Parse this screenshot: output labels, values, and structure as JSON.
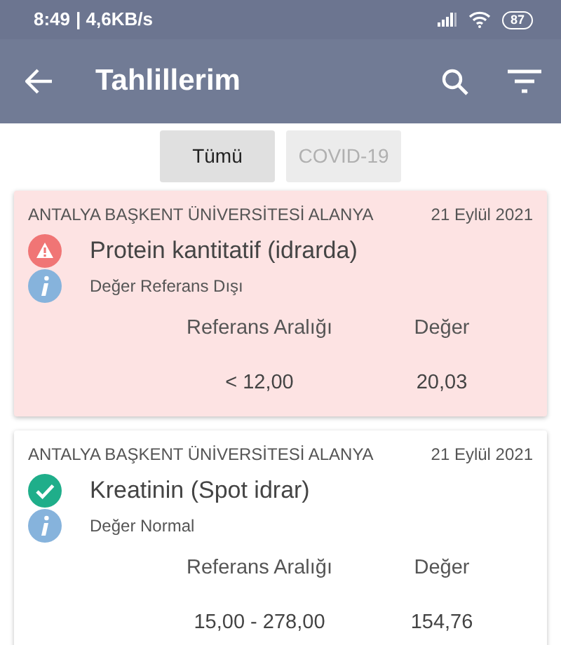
{
  "status_bar": {
    "time": "8:49",
    "speed": "| 4,6KB/s",
    "battery": "87"
  },
  "app_bar": {
    "title": "Tahlillerim"
  },
  "filters": [
    {
      "label": "Tümü",
      "selected": true
    },
    {
      "label": "COVID-19",
      "selected": false
    }
  ],
  "results": [
    {
      "kind": "abnormal",
      "lab": "ANTALYA BAŞKENT ÜNİVERSİTESİ ALANYA",
      "date": "21 Eylül 2021",
      "test": "Protein kantitatif (idrarda)",
      "status": "Değer Referans Dışı",
      "range_label": "Referans Aralığı",
      "value_label": "Değer",
      "range": "< 12,00",
      "value": "20,03"
    },
    {
      "kind": "normal",
      "lab": "ANTALYA BAŞKENT ÜNİVERSİTESİ ALANYA",
      "date": "21 Eylül 2021",
      "test": "Kreatinin (Spot idrar)",
      "status": "Değer Normal",
      "range_label": "Referans Aralığı",
      "value_label": "Değer",
      "range": "15,00 - 278,00",
      "value": "154,76"
    }
  ]
}
